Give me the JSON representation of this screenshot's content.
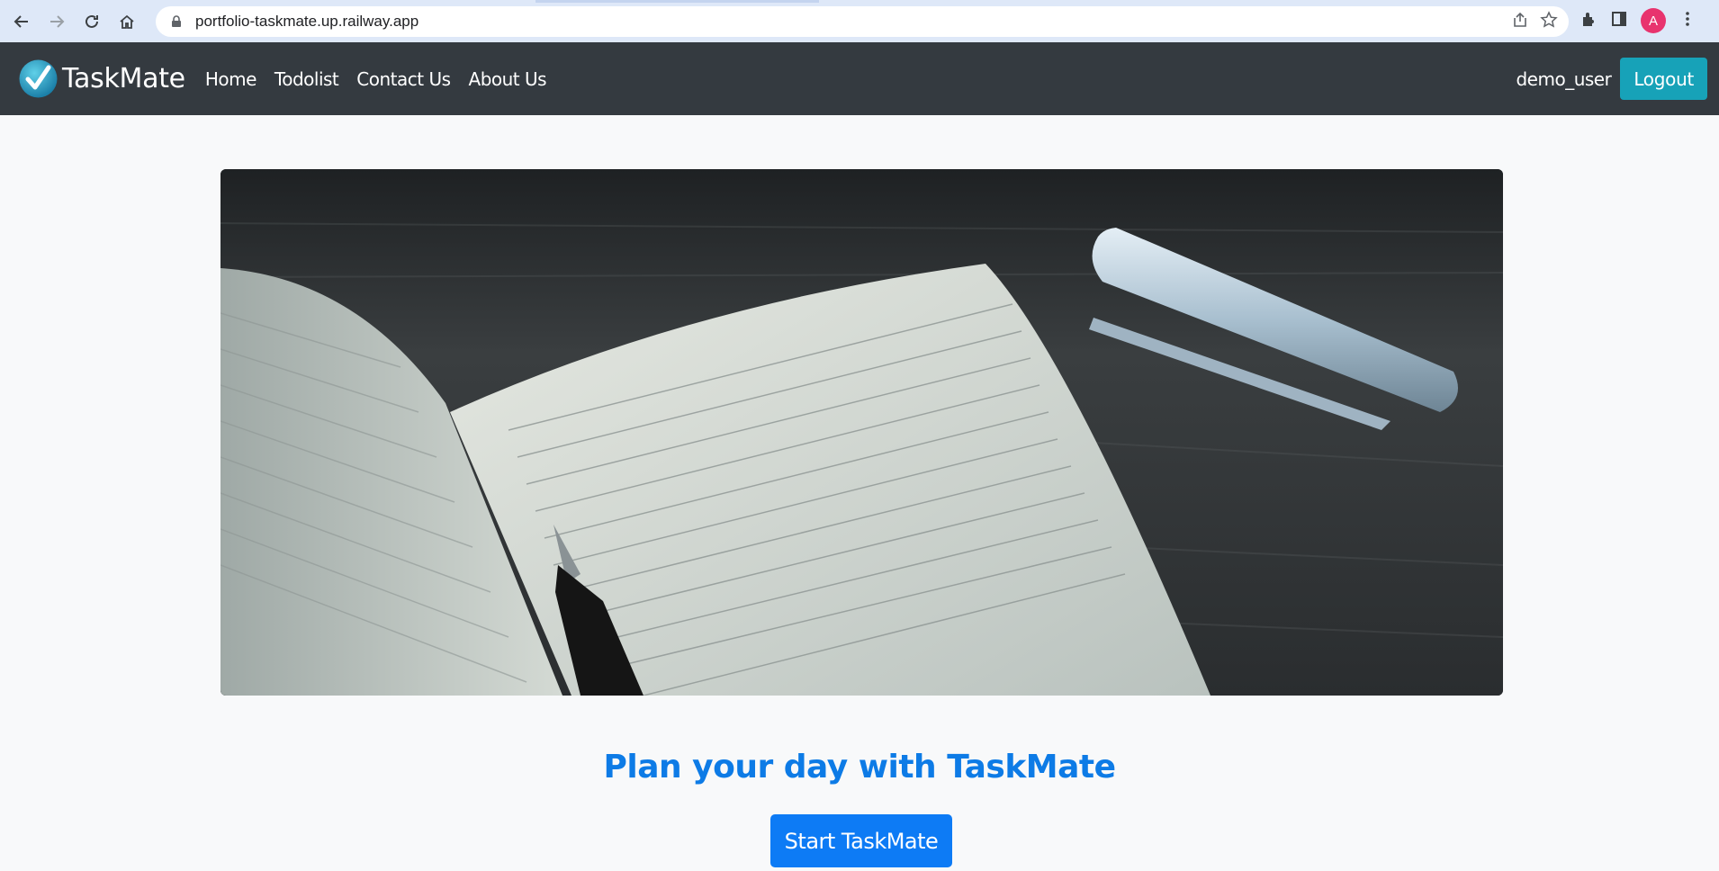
{
  "browser": {
    "url": "portfolio-taskmate.up.railway.app",
    "profile_initial": "A",
    "icons": [
      "back-icon",
      "forward-icon",
      "reload-icon",
      "home-icon",
      "lock-icon",
      "share-icon",
      "star-icon",
      "extensions-icon",
      "side-panel-icon",
      "more-icon"
    ]
  },
  "navbar": {
    "brand": "TaskMate",
    "links": [
      "Home",
      "Todolist",
      "Contact Us",
      "About Us"
    ],
    "username": "demo_user",
    "logout_label": "Logout"
  },
  "hero": {
    "headline": "Plan your day with TaskMate",
    "cta_label": "Start TaskMate"
  },
  "colors": {
    "navbar_bg": "#343a40",
    "logout_bg": "#17a2b8",
    "headline": "#0d7be6",
    "cta_bg": "#0d7bf5",
    "page_bg": "#f8f9fa"
  }
}
